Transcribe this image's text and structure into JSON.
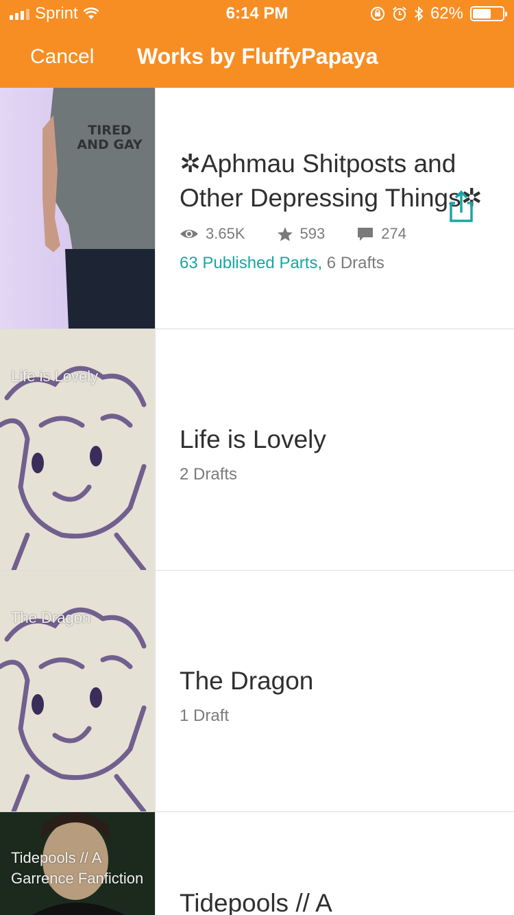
{
  "status_bar": {
    "carrier": "Sprint",
    "time": "6:14 PM",
    "battery": "62%",
    "battery_level": 0.62
  },
  "nav": {
    "cancel_label": "Cancel",
    "title": "Works by FluffyPapaya"
  },
  "stories": [
    {
      "cover_label": "",
      "shirt_text": "TIRED AND GAY",
      "title": "✲Aphmau Shitposts and Other Depressing Things✲",
      "views": "3.65K",
      "votes": "593",
      "comments": "274",
      "published": "63 Published Parts,",
      "drafts": "6 Drafts"
    },
    {
      "cover_label": "Life is Lovely",
      "title": "Life is Lovely",
      "drafts": "2 Drafts"
    },
    {
      "cover_label": "The Dragon",
      "title": "The Dragon",
      "drafts": "1 Draft"
    },
    {
      "cover_label": "Tidepools // A Garrence Fanfiction",
      "title": "Tidepools // A"
    }
  ],
  "colors": {
    "header": "#f78e24",
    "accent": "#1aa5a5"
  }
}
